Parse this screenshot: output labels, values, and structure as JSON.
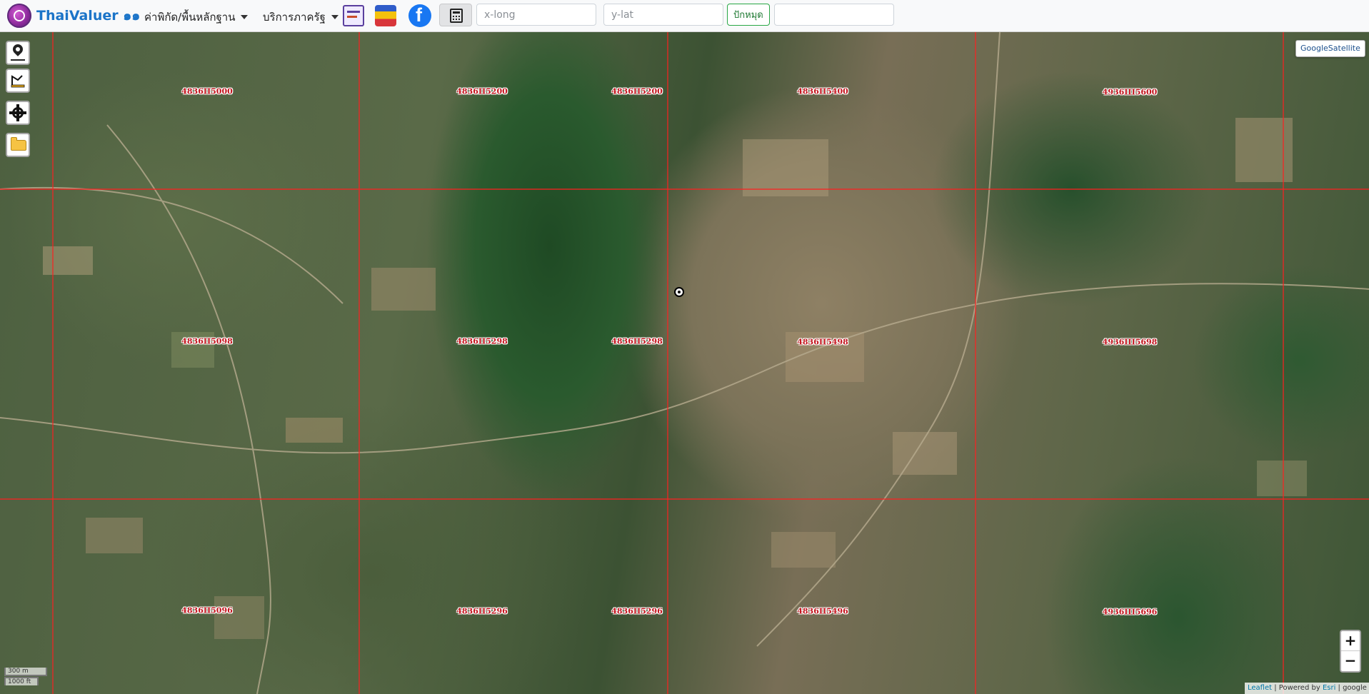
{
  "navbar": {
    "brand": "ThaiValuer ๑๑",
    "menu_coordinates": "ค่าพิกัด/พื้นหลักฐาน",
    "menu_services": "บริการภาครัฐ",
    "xlong_placeholder": "x-long",
    "ylat_placeholder": "y-lat",
    "pin_button": "ปักหมุด",
    "extra_input_value": ""
  },
  "map": {
    "layer_label": "GoogleSatellite",
    "sheet_labels": [
      "4836II5000",
      "4836II5200",
      "4836II5200",
      "4836II5400",
      "4936III5600",
      "4836II5098",
      "4836II5298",
      "4836II5298",
      "4836II5498",
      "4936III5698",
      "4836II5096",
      "4836II5296",
      "4836II5296",
      "4836II5496",
      "4936III5696"
    ],
    "zoom_in": "+",
    "zoom_out": "−",
    "scale_metric": "300 m",
    "scale_imperial": "1000 ft",
    "attribution": {
      "leaflet": "Leaflet",
      "powered": " | Powered by ",
      "esri": "Esri",
      "google": " | google"
    }
  }
}
